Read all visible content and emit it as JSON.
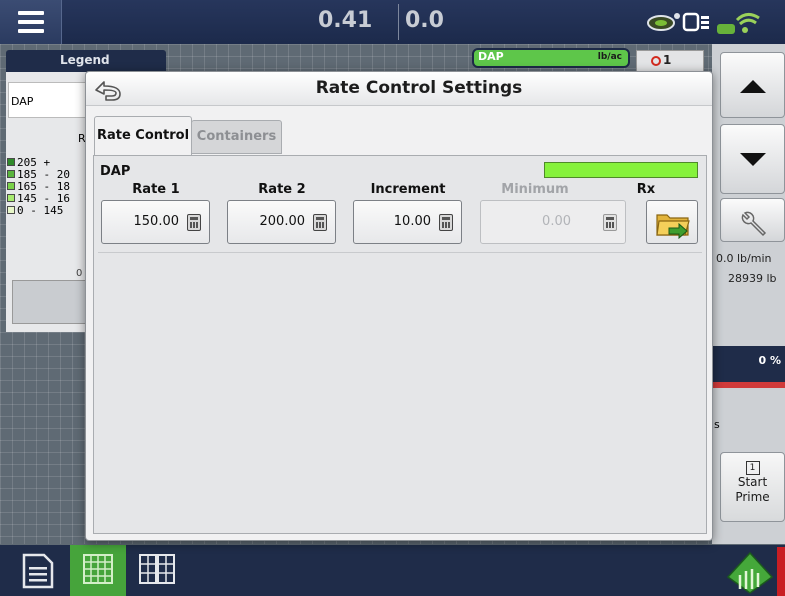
{
  "topbar": {
    "readout_left": "0.41",
    "readout_right": "0.0"
  },
  "background": {
    "legend_title": "Legend",
    "legend_product": "DAP",
    "legend_rate_label": "Ra",
    "legend_rows": [
      {
        "label": "205 +",
        "color": "#2f8a2a"
      },
      {
        "label": "185 - 20",
        "color": "#58b33c"
      },
      {
        "label": "165 - 18",
        "color": "#7ad149"
      },
      {
        "label": "145 - 16",
        "color": "#a7ea6f"
      },
      {
        "label": "0 - 145",
        "color": "#e8f7c9"
      }
    ],
    "legend_zero": "0",
    "product_bar_name": "DAP",
    "product_bar_unit": "lb/ac",
    "alarm_count": "1",
    "flow_rate": "0.0 lb/min",
    "total_weight": "28939 lb",
    "bin_percent": "0 %",
    "right_letter": "s",
    "prime_number": "1",
    "start_prime_line1": "Start",
    "start_prime_line2": "Prime"
  },
  "dialog": {
    "title": "Rate Control Settings",
    "tabs": [
      {
        "label": "Rate Control",
        "active": true
      },
      {
        "label": "Containers",
        "active": false
      }
    ],
    "product_name": "DAP",
    "product_color": "#86f23c",
    "columns": [
      {
        "label": "Rate 1",
        "value": "150.00",
        "enabled": true
      },
      {
        "label": "Rate 2",
        "value": "200.00",
        "enabled": true
      },
      {
        "label": "Increment",
        "value": "10.00",
        "enabled": true
      },
      {
        "label": "Minimum",
        "value": "0.00",
        "enabled": false
      }
    ],
    "rx_label": "Rx"
  },
  "colors": {
    "top_bar": "#1f2c49",
    "active_bottom_button": "#46a43b",
    "product_green": "#86f23c"
  },
  "icons": {
    "menu": "hamburger-menu-icon",
    "back": "back-arrow-icon",
    "calculator": "calculator-icon",
    "rx": "prescription-folder-icon",
    "up": "up-arrow-icon",
    "down": "down-arrow-icon",
    "wrench": "wrench-icon",
    "home": "home-icon"
  }
}
